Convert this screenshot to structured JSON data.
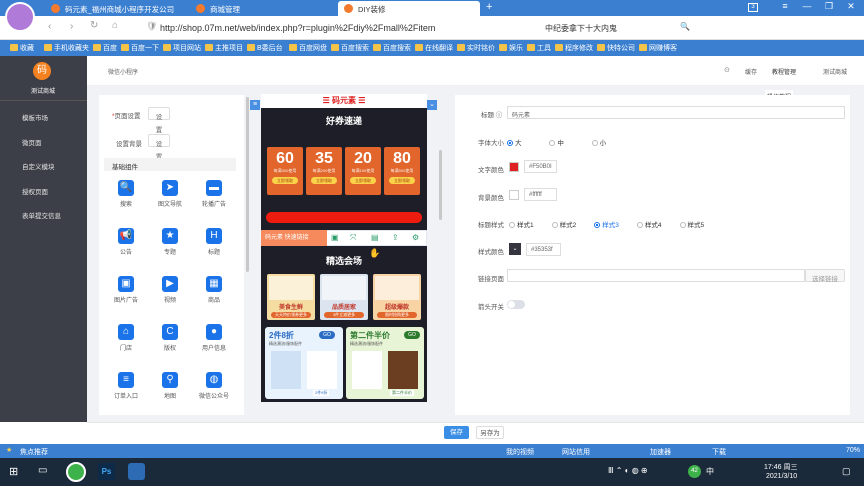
{
  "browser": {
    "tabs": [
      {
        "label": "码元素_福州商城小程序开发公司"
      },
      {
        "label": "商城管理"
      },
      {
        "label": "DIY装修"
      }
    ],
    "url": "http://shop.07m.net/web/index.php?r=plugin%2Fdiy%2Fmall%2Fitem",
    "search_hint": "中纪委拿下十大内鬼",
    "tab_count": "3",
    "bookmarks": [
      "收藏",
      "手机收藏夹",
      "百度",
      "百度一下",
      "项目网站",
      "主推项目",
      "B委后台",
      "百度网盘",
      "百度搜索",
      "百度搜索",
      "在线翻译",
      "实时铭价",
      "娱乐",
      "工具",
      "程序修改",
      "快特公司",
      "网赚博客"
    ]
  },
  "sidebar": {
    "logo": "码",
    "shop": "测试商城",
    "items": [
      {
        "label": "模板市场"
      },
      {
        "label": "微页面"
      },
      {
        "label": "自定义模块"
      },
      {
        "label": "授权页面"
      },
      {
        "label": "表单提交信息"
      }
    ]
  },
  "header": {
    "breadcrumb": "微信小程序",
    "cache": "缓存",
    "tutorial": "教程管理",
    "tutorial_tip": "操作教程",
    "user": "测试商城"
  },
  "left_panel": {
    "page_setting": "页面设置",
    "set_btn": "设置",
    "bg_setting": "设置背景",
    "set_btn2": "设置",
    "section": "基础组件",
    "components": [
      {
        "label": "搜索",
        "icon": "🔍"
      },
      {
        "label": "图文导航",
        "icon": "➤"
      },
      {
        "label": "轮播广告",
        "icon": "▬"
      },
      {
        "label": "公告",
        "icon": "📢"
      },
      {
        "label": "专题",
        "icon": "★"
      },
      {
        "label": "标题",
        "icon": "H"
      },
      {
        "label": "图片广告",
        "icon": "▣"
      },
      {
        "label": "视频",
        "icon": "▶"
      },
      {
        "label": "商品",
        "icon": "▦"
      },
      {
        "label": "门店",
        "icon": "⌂"
      },
      {
        "label": "版权",
        "icon": "C"
      },
      {
        "label": "用户信息",
        "icon": "●"
      },
      {
        "label": "订单入口",
        "icon": "≡"
      },
      {
        "label": "地图",
        "icon": "⚲"
      },
      {
        "label": "微信公众号",
        "icon": "◍"
      }
    ]
  },
  "phone": {
    "header_title": "码元素",
    "section1": "好券速递",
    "coupons": [
      {
        "value": "60",
        "cond": "每满300使用",
        "btn": "立即领取"
      },
      {
        "value": "35",
        "cond": "每满200使用",
        "btn": "立即领取"
      },
      {
        "value": "20",
        "cond": "每满100使用",
        "btn": "立即领取"
      },
      {
        "value": "80",
        "cond": "每满500使用",
        "btn": "立即领取"
      }
    ],
    "toolbar_text": "码元素 快速链接",
    "section2": "精选会场",
    "venues": [
      {
        "label": "美食生鲜",
        "sub": "天天特价领券更多"
      },
      {
        "label": "品质居家",
        "sub": "3件立减更多"
      },
      {
        "label": "超级爆款",
        "sub": "限时抢购更多"
      }
    ],
    "promo1": {
      "title": "2件8折",
      "sub": "精选潮流/服饰配件",
      "go": "GO",
      "tag": "2件8折"
    },
    "promo2": {
      "title": "第二件半价",
      "sub": "精选潮流/服饰配件",
      "go": "GO",
      "tag": "第二件半价"
    }
  },
  "right_panel": {
    "title_label": "标题",
    "title_value": "码元素",
    "fontsize_label": "字体大小",
    "fontsize_options": [
      "大",
      "中",
      "小"
    ],
    "textcolor_label": "文字颜色",
    "textcolor_value": "#F50B0I",
    "bgcolor_label": "背景颜色",
    "bgcolor_value": "#ffffff",
    "style_label": "标题样式",
    "style_options": [
      "样式1",
      "样式2",
      "样式3",
      "样式4",
      "样式5"
    ],
    "stylecolor_label": "样式颜色",
    "stylecolor_value": "#35353f",
    "link_label": "链接页面",
    "link_btn": "选择链接",
    "arrow_label": "箭头开关",
    "colors": {
      "text": "#e02020",
      "bg": "#ffffff",
      "style": "#35353f"
    }
  },
  "footer": {
    "save": "保存",
    "save_as": "另存为"
  },
  "status": {
    "left": "焦点推荐",
    "video": "我的视频",
    "net": "网站信用",
    "accel": "加速器",
    "download": "下载",
    "zoom": "70%"
  },
  "taskbar": {
    "time": "17:46 周三",
    "date": "2021/3/10",
    "notif": "42",
    "ime": "中"
  }
}
